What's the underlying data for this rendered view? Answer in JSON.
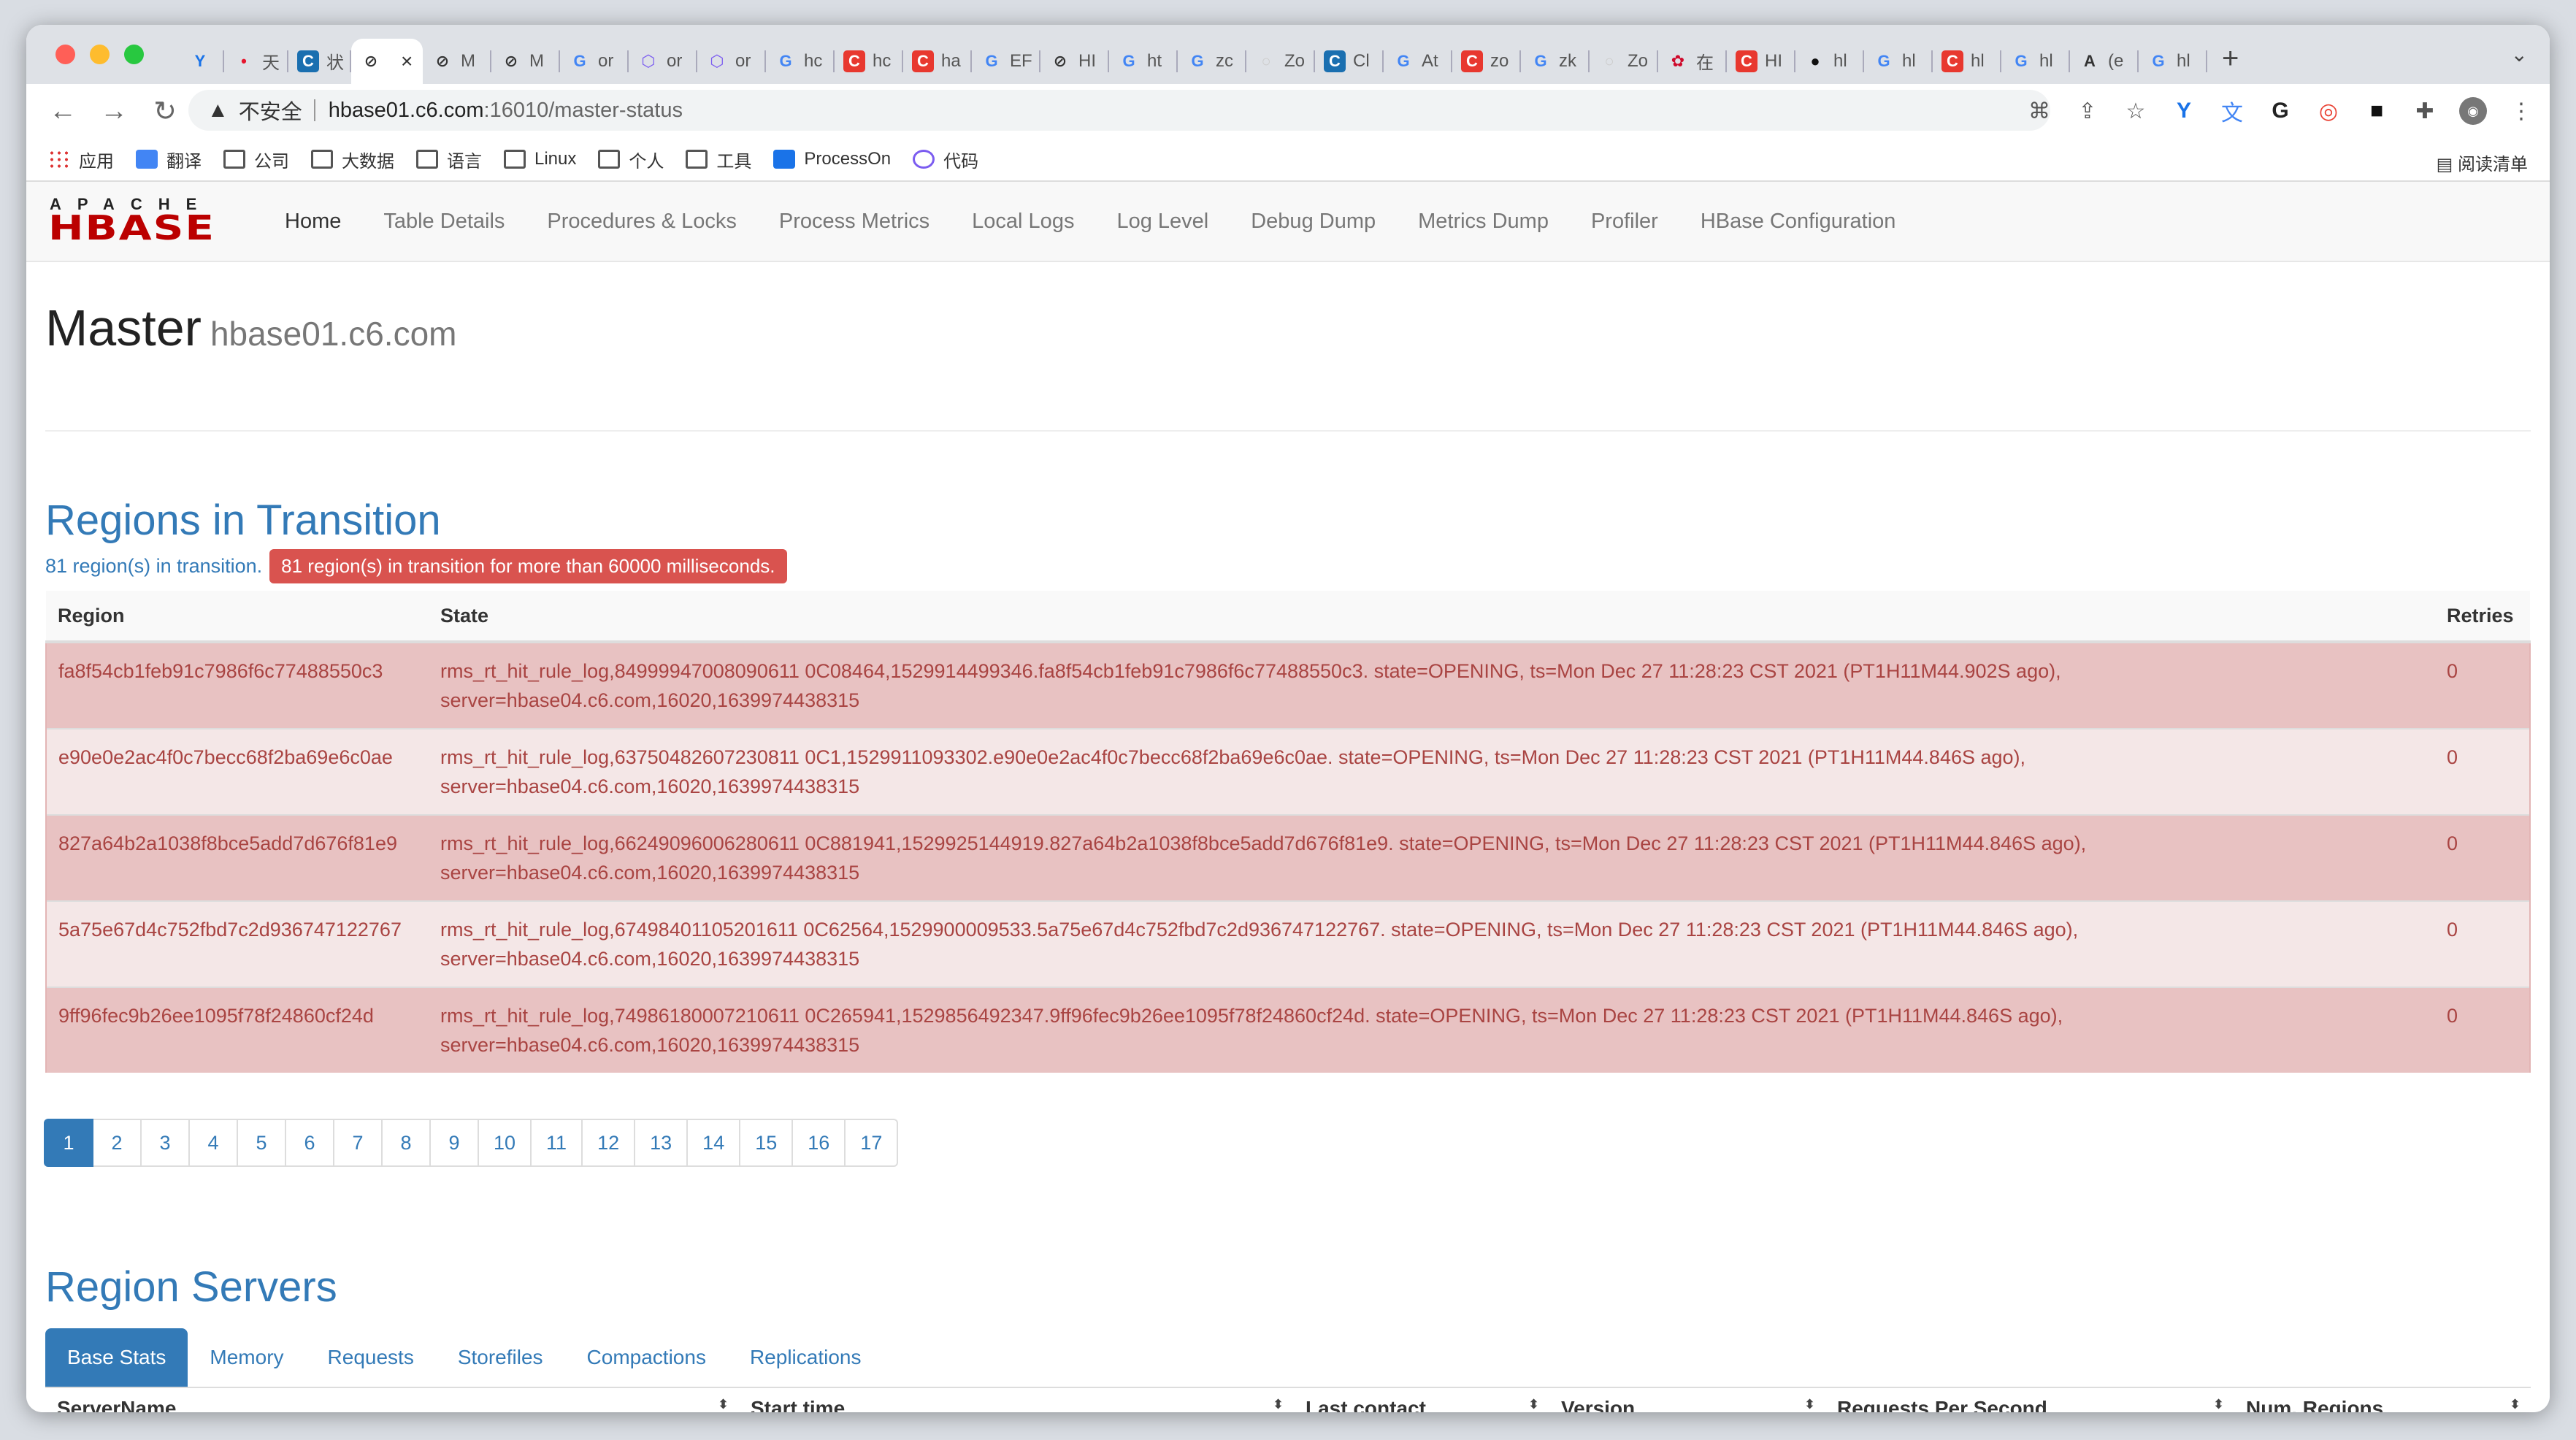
{
  "browser": {
    "tabs": [
      {
        "label": "",
        "icon": "y-icon",
        "color": "#1a73e8",
        "glyph": "Y"
      },
      {
        "label": "天",
        "icon": "weibo-icon",
        "color": "#e6162d",
        "glyph": "•"
      },
      {
        "label": "状",
        "icon": "c-icon",
        "color": "#1a6fb0",
        "glyph": "C"
      },
      {
        "label": "",
        "icon": "globe-icon",
        "color": "#333",
        "glyph": "⊘",
        "active": true
      },
      {
        "label": "M",
        "icon": "globe-icon",
        "color": "#333",
        "glyph": "⊘"
      },
      {
        "label": "M",
        "icon": "globe-icon",
        "color": "#333",
        "glyph": "⊘"
      },
      {
        "label": "or",
        "icon": "google-icon",
        "color": "#4285f4",
        "glyph": "G"
      },
      {
        "label": "or",
        "icon": "hexagon-icon",
        "color": "#7b5cf0",
        "glyph": "⬡"
      },
      {
        "label": "or",
        "icon": "hexagon-icon",
        "color": "#7b5cf0",
        "glyph": "⬡"
      },
      {
        "label": "hc",
        "icon": "google-icon",
        "color": "#4285f4",
        "glyph": "G"
      },
      {
        "label": "hc",
        "icon": "csdn-icon",
        "color": "#e8382f",
        "glyph": "C"
      },
      {
        "label": "ha",
        "icon": "csdn-icon",
        "color": "#e8382f",
        "glyph": "C"
      },
      {
        "label": "EF",
        "icon": "google-icon",
        "color": "#4285f4",
        "glyph": "G"
      },
      {
        "label": "HI",
        "icon": "globe-icon",
        "color": "#333",
        "glyph": "⊘"
      },
      {
        "label": "ht",
        "icon": "google-icon",
        "color": "#4285f4",
        "glyph": "G"
      },
      {
        "label": "zc",
        "icon": "google-icon",
        "color": "#4285f4",
        "glyph": "G"
      },
      {
        "label": "Zo",
        "icon": "blank-icon",
        "color": "#ccc",
        "glyph": "○"
      },
      {
        "label": "Cl",
        "icon": "c-icon",
        "color": "#1a6fb0",
        "glyph": "C"
      },
      {
        "label": "At",
        "icon": "google-icon",
        "color": "#4285f4",
        "glyph": "G"
      },
      {
        "label": "zo",
        "icon": "csdn-icon",
        "color": "#e8382f",
        "glyph": "C"
      },
      {
        "label": "zk",
        "icon": "google-icon",
        "color": "#4285f4",
        "glyph": "G"
      },
      {
        "label": "Zo",
        "icon": "blank-icon",
        "color": "#ccc",
        "glyph": "○"
      },
      {
        "label": "在",
        "icon": "huawei-icon",
        "color": "#cf0a2c",
        "glyph": "✿"
      },
      {
        "label": "HI",
        "icon": "csdn-icon",
        "color": "#e8382f",
        "glyph": "C"
      },
      {
        "label": "hl",
        "icon": "github-icon",
        "color": "#111",
        "glyph": "●"
      },
      {
        "label": "hl",
        "icon": "google-icon",
        "color": "#4285f4",
        "glyph": "G"
      },
      {
        "label": "hl",
        "icon": "csdn-icon",
        "color": "#e8382f",
        "glyph": "C"
      },
      {
        "label": "hl",
        "icon": "google-icon",
        "color": "#4285f4",
        "glyph": "G"
      },
      {
        "label": "(e",
        "icon": "translate-icon",
        "color": "#333",
        "glyph": "A"
      },
      {
        "label": "hl",
        "icon": "google-icon",
        "color": "#4285f4",
        "glyph": "G"
      }
    ],
    "url": {
      "security": "不安全",
      "host": "hbase01.c6.com",
      "path": ":16010/master-status"
    },
    "bookmarks": [
      {
        "label": "应用",
        "icon": "apps-grid-icon"
      },
      {
        "label": "翻译",
        "icon": "translate-icon"
      },
      {
        "label": "公司",
        "icon": "folder-icon"
      },
      {
        "label": "大数据",
        "icon": "folder-icon"
      },
      {
        "label": "语言",
        "icon": "folder-icon"
      },
      {
        "label": "Linux",
        "icon": "folder-icon"
      },
      {
        "label": "个人",
        "icon": "folder-icon"
      },
      {
        "label": "工具",
        "icon": "folder-icon"
      },
      {
        "label": "ProcessOn",
        "icon": "processon-icon"
      },
      {
        "label": "代码",
        "icon": "hexagon-icon"
      }
    ],
    "reading_list": "阅读清单"
  },
  "hbase": {
    "logo_top": "APACHE",
    "logo_main": "HBASE",
    "nav": [
      "Home",
      "Table Details",
      "Procedures & Locks",
      "Process Metrics",
      "Local Logs",
      "Log Level",
      "Debug Dump",
      "Metrics Dump",
      "Profiler",
      "HBase Configuration"
    ],
    "title": "Master",
    "host": "hbase01.c6.com",
    "rit": {
      "heading": "Regions in Transition",
      "count_text": "81 region(s) in transition.",
      "badge": "81 region(s) in transition for more than 60000 milliseconds.",
      "columns": [
        "Region",
        "State",
        "Retries"
      ],
      "rows": [
        {
          "region": "fa8f54cb1feb91c7986f6c77488550c3",
          "state1": "rms_rt_hit_rule_log,84999947008090611 0C08464,1529914499346.fa8f54cb1feb91c7986f6c77488550c3. state=OPENING, ts=Mon Dec 27 11:28:23 CST 2021 (PT1H11M44.902S ago),",
          "state2": "server=hbase04.c6.com,16020,1639974438315",
          "retries": "0"
        },
        {
          "region": "e90e0e2ac4f0c7becc68f2ba69e6c0ae",
          "state1": "rms_rt_hit_rule_log,63750482607230811 0C1,1529911093302.e90e0e2ac4f0c7becc68f2ba69e6c0ae. state=OPENING, ts=Mon Dec 27 11:28:23 CST 2021 (PT1H11M44.846S ago),",
          "state2": "server=hbase04.c6.com,16020,1639974438315",
          "retries": "0"
        },
        {
          "region": "827a64b2a1038f8bce5add7d676f81e9",
          "state1": "rms_rt_hit_rule_log,66249096006280611 0C881941,1529925144919.827a64b2a1038f8bce5add7d676f81e9. state=OPENING, ts=Mon Dec 27 11:28:23 CST 2021 (PT1H11M44.846S ago),",
          "state2": "server=hbase04.c6.com,16020,1639974438315",
          "retries": "0"
        },
        {
          "region": "5a75e67d4c752fbd7c2d936747122767",
          "state1": "rms_rt_hit_rule_log,67498401105201611 0C62564,1529900009533.5a75e67d4c752fbd7c2d936747122767. state=OPENING, ts=Mon Dec 27 11:28:23 CST 2021 (PT1H11M44.846S ago),",
          "state2": "server=hbase04.c6.com,16020,1639974438315",
          "retries": "0"
        },
        {
          "region": "9ff96fec9b26ee1095f78f24860cf24d",
          "state1": "rms_rt_hit_rule_log,74986180007210611 0C265941,1529856492347.9ff96fec9b26ee1095f78f24860cf24d. state=OPENING, ts=Mon Dec 27 11:28:23 CST 2021 (PT1H11M44.846S ago),",
          "state2": "server=hbase04.c6.com,16020,1639974438315",
          "retries": "0"
        }
      ],
      "pages": [
        "1",
        "2",
        "3",
        "4",
        "5",
        "6",
        "7",
        "8",
        "9",
        "10",
        "11",
        "12",
        "13",
        "14",
        "15",
        "16",
        "17"
      ]
    },
    "rs": {
      "heading": "Region Servers",
      "tabs": [
        "Base Stats",
        "Memory",
        "Requests",
        "Storefiles",
        "Compactions",
        "Replications"
      ],
      "columns": [
        "ServerName",
        "Start time",
        "Last contact",
        "Version",
        "Requests Per Second",
        "Num. Regions"
      ]
    }
  },
  "colors": {
    "brand_red": "#bb0000",
    "link_blue": "#337ab7",
    "danger": "#d9534f",
    "danger_text": "#a94442"
  }
}
